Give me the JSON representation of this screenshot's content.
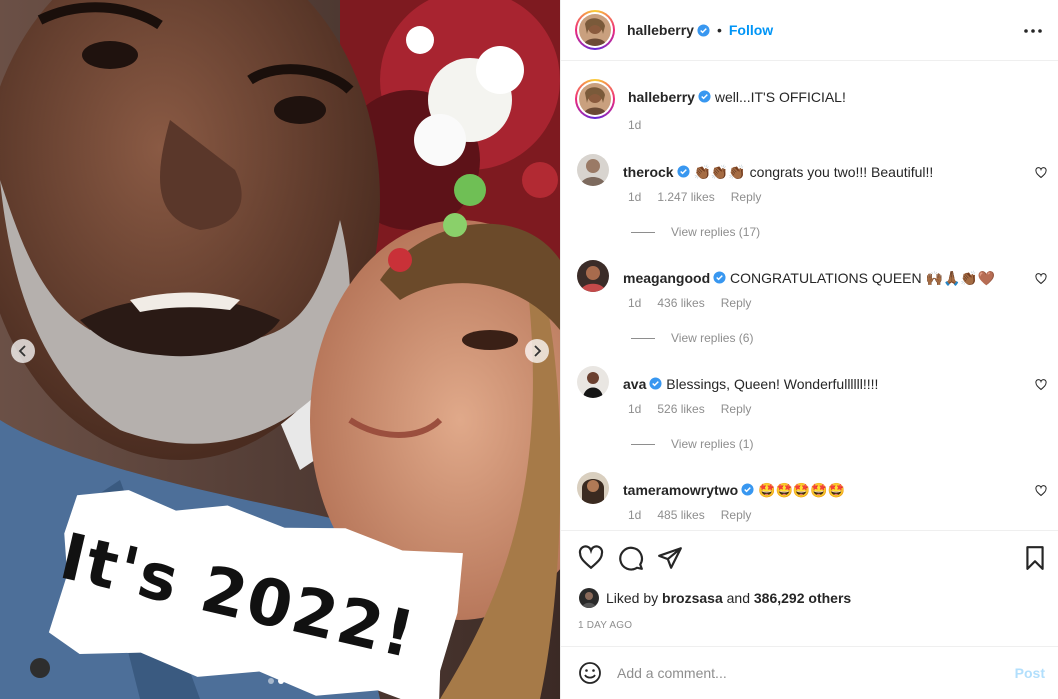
{
  "post": {
    "author": "halleberry",
    "follow_label": "Follow",
    "separator": "•",
    "sticker_text": "It's 2022!"
  },
  "caption": {
    "username": "halleberry",
    "text": "well...IT'S OFFICIAL!",
    "time": "1d"
  },
  "comments": [
    {
      "username": "therock",
      "text": "👏🏾👏🏾👏🏾 congrats you two!!! Beautiful!!",
      "time": "1d",
      "likes": "1.247 likes",
      "reply": "Reply",
      "view_replies": "View replies (17)"
    },
    {
      "username": "meagangood",
      "text": "CONGRATULATIONS QUEEN 🙌🏾🙏🏾👏🏾🤎",
      "time": "1d",
      "likes": "436 likes",
      "reply": "Reply",
      "view_replies": "View replies (6)"
    },
    {
      "username": "ava",
      "text": "Blessings, Queen! Wonderfullllll!!!!",
      "time": "1d",
      "likes": "526 likes",
      "reply": "Reply",
      "view_replies": "View replies (1)"
    },
    {
      "username": "tameramowrytwo",
      "text": "🤩🤩🤩🤩🤩",
      "time": "1d",
      "likes": "485 likes",
      "reply": "Reply"
    }
  ],
  "likes": {
    "prefix": "Liked by",
    "user": "brozsasa",
    "middle": "and",
    "others": "386,292 others"
  },
  "timestamp": "1 DAY AGO",
  "add_comment": {
    "placeholder": "Add a comment...",
    "post_label": "Post"
  },
  "colors": {
    "accent": "#0095f6",
    "verified": "#3897f0",
    "post_disabled": "#b2dffc"
  },
  "icons": [
    "chevron-left-icon",
    "chevron-right-icon",
    "more-icon",
    "verified-icon",
    "heart-icon",
    "comment-icon",
    "share-icon",
    "bookmark-icon",
    "emoji-icon"
  ]
}
